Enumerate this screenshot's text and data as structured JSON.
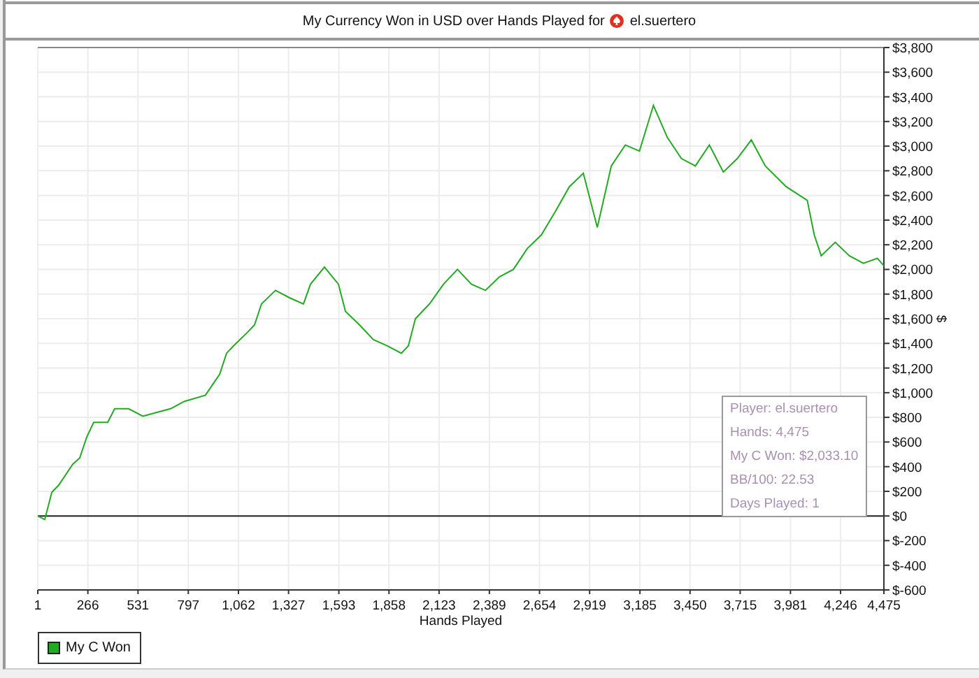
{
  "title": {
    "text": "My Currency Won in USD over Hands Played for",
    "player": "el.suertero"
  },
  "chart": {
    "chart_data": {
      "type": "line",
      "xlabel": "Hands Played",
      "ylabel": "$",
      "grid": true,
      "x": [
        1,
        38,
        75,
        112,
        186,
        223,
        260,
        297,
        371,
        408,
        482,
        556,
        630,
        703,
        777,
        888,
        963,
        999,
        1036,
        1110,
        1147,
        1184,
        1258,
        1332,
        1406,
        1443,
        1517,
        1591,
        1628,
        1702,
        1776,
        1850,
        1924,
        1961,
        1998,
        2072,
        2146,
        2220,
        2294,
        2368,
        2442,
        2516,
        2590,
        2664,
        2738,
        2812,
        2886,
        2960,
        3034,
        3108,
        3182,
        3256,
        3330,
        3404,
        3478,
        3552,
        3626,
        3700,
        3774,
        3848,
        3959,
        4070,
        4107,
        4144,
        4218,
        4292,
        4366,
        4440,
        4475
      ],
      "series": [
        {
          "name": "My C Won",
          "color": "#22aa22",
          "values": [
            0,
            -30,
            190,
            250,
            420,
            470,
            640,
            760,
            760,
            870,
            870,
            810,
            840,
            870,
            930,
            980,
            1150,
            1320,
            1380,
            1490,
            1550,
            1720,
            1830,
            1770,
            1720,
            1880,
            2020,
            1880,
            1660,
            1550,
            1430,
            1380,
            1320,
            1380,
            1600,
            1720,
            1880,
            2000,
            1880,
            1830,
            1940,
            2000,
            2170,
            2280,
            2470,
            2670,
            2780,
            2340,
            2840,
            3010,
            2960,
            3330,
            3070,
            2900,
            2840,
            3010,
            2790,
            2900,
            3050,
            2840,
            2670,
            2560,
            2280,
            2110,
            2220,
            2110,
            2050,
            2090,
            2030
          ]
        }
      ],
      "xlim": [
        1,
        4475
      ],
      "ylim": [
        -600,
        3800
      ],
      "xticks": [
        {
          "value": 1,
          "label": "1"
        },
        {
          "value": 266,
          "label": "266"
        },
        {
          "value": 531,
          "label": "531"
        },
        {
          "value": 797,
          "label": "797"
        },
        {
          "value": 1062,
          "label": "1,062"
        },
        {
          "value": 1327,
          "label": "1,327"
        },
        {
          "value": 1593,
          "label": "1,593"
        },
        {
          "value": 1858,
          "label": "1,858"
        },
        {
          "value": 2123,
          "label": "2,123"
        },
        {
          "value": 2389,
          "label": "2,389"
        },
        {
          "value": 2654,
          "label": "2,654"
        },
        {
          "value": 2919,
          "label": "2,919"
        },
        {
          "value": 3185,
          "label": "3,185"
        },
        {
          "value": 3450,
          "label": "3,450"
        },
        {
          "value": 3715,
          "label": "3,715"
        },
        {
          "value": 3981,
          "label": "3,981"
        },
        {
          "value": 4246,
          "label": "4,246"
        },
        {
          "value": 4475,
          "label": "4,475"
        }
      ],
      "yticks": [
        {
          "value": -600,
          "label": "$-600"
        },
        {
          "value": -400,
          "label": "$-400"
        },
        {
          "value": -200,
          "label": "$-200"
        },
        {
          "value": 0,
          "label": "$0"
        },
        {
          "value": 200,
          "label": "$200"
        },
        {
          "value": 400,
          "label": "$400"
        },
        {
          "value": 600,
          "label": "$600"
        },
        {
          "value": 800,
          "label": "$800"
        },
        {
          "value": 1000,
          "label": "$1,000"
        },
        {
          "value": 1200,
          "label": "$1,200"
        },
        {
          "value": 1400,
          "label": "$1,400"
        },
        {
          "value": 1600,
          "label": "$1,600"
        },
        {
          "value": 1800,
          "label": "$1,800"
        },
        {
          "value": 2000,
          "label": "$2,000"
        },
        {
          "value": 2200,
          "label": "$2,200"
        },
        {
          "value": 2400,
          "label": "$2,400"
        },
        {
          "value": 2600,
          "label": "$2,600"
        },
        {
          "value": 2800,
          "label": "$2,800"
        },
        {
          "value": 3000,
          "label": "$3,000"
        },
        {
          "value": 3200,
          "label": "$3,200"
        },
        {
          "value": 3400,
          "label": "$3,400"
        },
        {
          "value": 3600,
          "label": "$3,600"
        },
        {
          "value": 3800,
          "label": "$3,800"
        }
      ]
    },
    "info_box": [
      "Player: el.suertero",
      "Hands: 4,475",
      "My C Won: $2,033.10",
      "BB/100: 22.53",
      "Days Played: 1"
    ]
  }
}
